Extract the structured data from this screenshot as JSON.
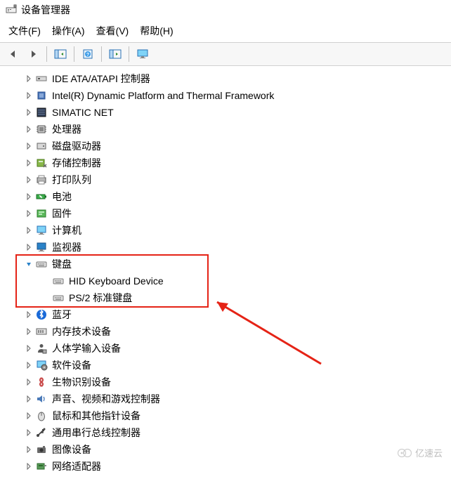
{
  "window": {
    "title": "设备管理器"
  },
  "menu": {
    "file": "文件(F)",
    "action": "操作(A)",
    "view": "查看(V)",
    "help": "帮助(H)"
  },
  "tree": {
    "items": [
      {
        "label": "IDE ATA/ATAPI 控制器",
        "icon": "ide",
        "depth": 1,
        "expander": "collapsed"
      },
      {
        "label": "Intel(R) Dynamic Platform and Thermal Framework",
        "icon": "chip",
        "depth": 1,
        "expander": "collapsed"
      },
      {
        "label": "SIMATIC NET",
        "icon": "rack",
        "depth": 1,
        "expander": "collapsed"
      },
      {
        "label": "处理器",
        "icon": "cpu",
        "depth": 1,
        "expander": "collapsed"
      },
      {
        "label": "磁盘驱动器",
        "icon": "disk",
        "depth": 1,
        "expander": "collapsed"
      },
      {
        "label": "存储控制器",
        "icon": "storage",
        "depth": 1,
        "expander": "collapsed"
      },
      {
        "label": "打印队列",
        "icon": "printer",
        "depth": 1,
        "expander": "collapsed"
      },
      {
        "label": "电池",
        "icon": "battery",
        "depth": 1,
        "expander": "collapsed"
      },
      {
        "label": "固件",
        "icon": "firmware",
        "depth": 1,
        "expander": "collapsed"
      },
      {
        "label": "计算机",
        "icon": "computer",
        "depth": 1,
        "expander": "collapsed"
      },
      {
        "label": "监视器",
        "icon": "monitor",
        "depth": 1,
        "expander": "collapsed"
      },
      {
        "label": "键盘",
        "icon": "keyboard",
        "depth": 1,
        "expander": "expanded"
      },
      {
        "label": "HID Keyboard Device",
        "icon": "keyboard",
        "depth": 2,
        "expander": "none"
      },
      {
        "label": "PS/2 标准键盘",
        "icon": "keyboard",
        "depth": 2,
        "expander": "none"
      },
      {
        "label": "蓝牙",
        "icon": "bluetooth",
        "depth": 1,
        "expander": "collapsed"
      },
      {
        "label": "内存技术设备",
        "icon": "memory",
        "depth": 1,
        "expander": "collapsed"
      },
      {
        "label": "人体学输入设备",
        "icon": "hid",
        "depth": 1,
        "expander": "collapsed"
      },
      {
        "label": "软件设备",
        "icon": "soft",
        "depth": 1,
        "expander": "collapsed"
      },
      {
        "label": "生物识别设备",
        "icon": "bio",
        "depth": 1,
        "expander": "collapsed"
      },
      {
        "label": "声音、视频和游戏控制器",
        "icon": "audio",
        "depth": 1,
        "expander": "collapsed"
      },
      {
        "label": "鼠标和其他指针设备",
        "icon": "mouse",
        "depth": 1,
        "expander": "collapsed"
      },
      {
        "label": "通用串行总线控制器",
        "icon": "usb",
        "depth": 1,
        "expander": "collapsed"
      },
      {
        "label": "图像设备",
        "icon": "camera",
        "depth": 1,
        "expander": "collapsed"
      },
      {
        "label": "网络适配器",
        "icon": "network",
        "depth": 1,
        "expander": "collapsed"
      }
    ]
  },
  "highlight": {
    "top_item_index": 11,
    "bottom_item_index": 13
  },
  "watermark": {
    "text": "亿速云"
  }
}
